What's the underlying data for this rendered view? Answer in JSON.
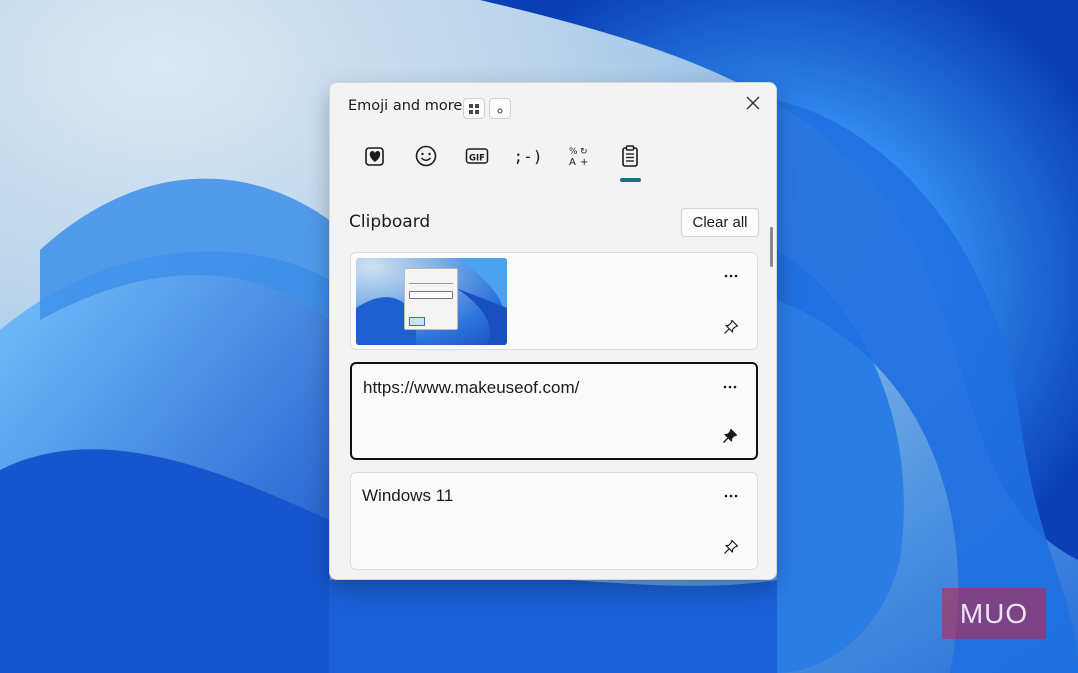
{
  "picker": {
    "title": "Emoji and more",
    "close_icon": "close-icon",
    "tabs": [
      {
        "name": "favorites",
        "icon": "heart-note-icon"
      },
      {
        "name": "emoji",
        "icon": "smiley-icon"
      },
      {
        "name": "gif",
        "icon": "gif-icon",
        "label": "GIF"
      },
      {
        "name": "kaomoji",
        "icon": "kaomoji-icon",
        "label": ";-)"
      },
      {
        "name": "symbols",
        "icon": "symbols-icon"
      },
      {
        "name": "clipboard",
        "icon": "clipboard-icon",
        "selected": true
      }
    ],
    "section_title": "Clipboard",
    "clear_all_label": "Clear all",
    "items": [
      {
        "type": "image",
        "pinned": false
      },
      {
        "type": "text",
        "text": "https://www.makeuseof.com/",
        "pinned": true,
        "selected": true
      },
      {
        "type": "text",
        "text": "Windows 11",
        "pinned": false
      }
    ]
  },
  "watermark": {
    "text": "MUO"
  },
  "colors": {
    "accent": "#1a6f86",
    "wallpaper_blue": "#2a6fd6"
  }
}
